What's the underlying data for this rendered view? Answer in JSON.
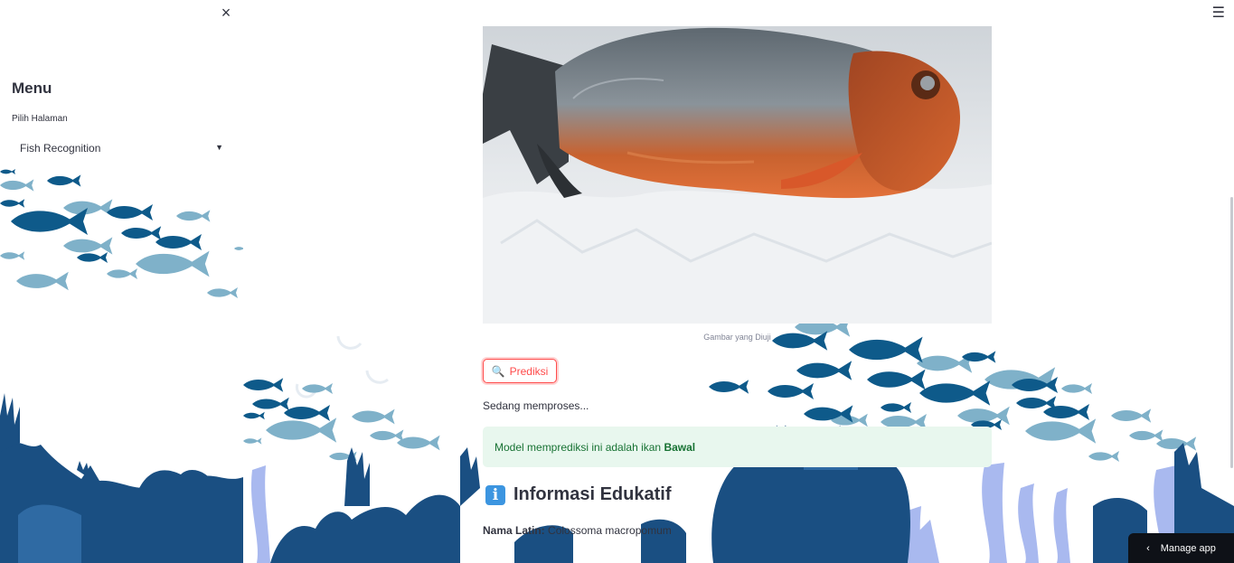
{
  "sidebar": {
    "close_icon": "×",
    "menu_title": "Menu",
    "select_label": "Pilih Halaman",
    "select_value": "Fish Recognition"
  },
  "main": {
    "image_caption": "Gambar yang Diuji",
    "predict_button": "Prediksi",
    "processing_text": "Sedang memproses...",
    "result_prefix": "Model memprediksi ini adalah ikan",
    "result_fish": "Bawal",
    "edu_icon": "i",
    "edu_title": "Informasi Edukatif",
    "latin_label": "Nama Latin:",
    "latin_value": "Colossoma macropomum"
  },
  "footer": {
    "manage_app": "Manage app"
  },
  "colors": {
    "accent": "#ff4b4b",
    "success_bg": "#e8f7ee",
    "success_text": "#177233",
    "fish_dark": "#0e5a8a",
    "fish_light": "#7fb1c9",
    "reef_dark": "#1a4f82",
    "reef_light": "#a9b9ef"
  }
}
